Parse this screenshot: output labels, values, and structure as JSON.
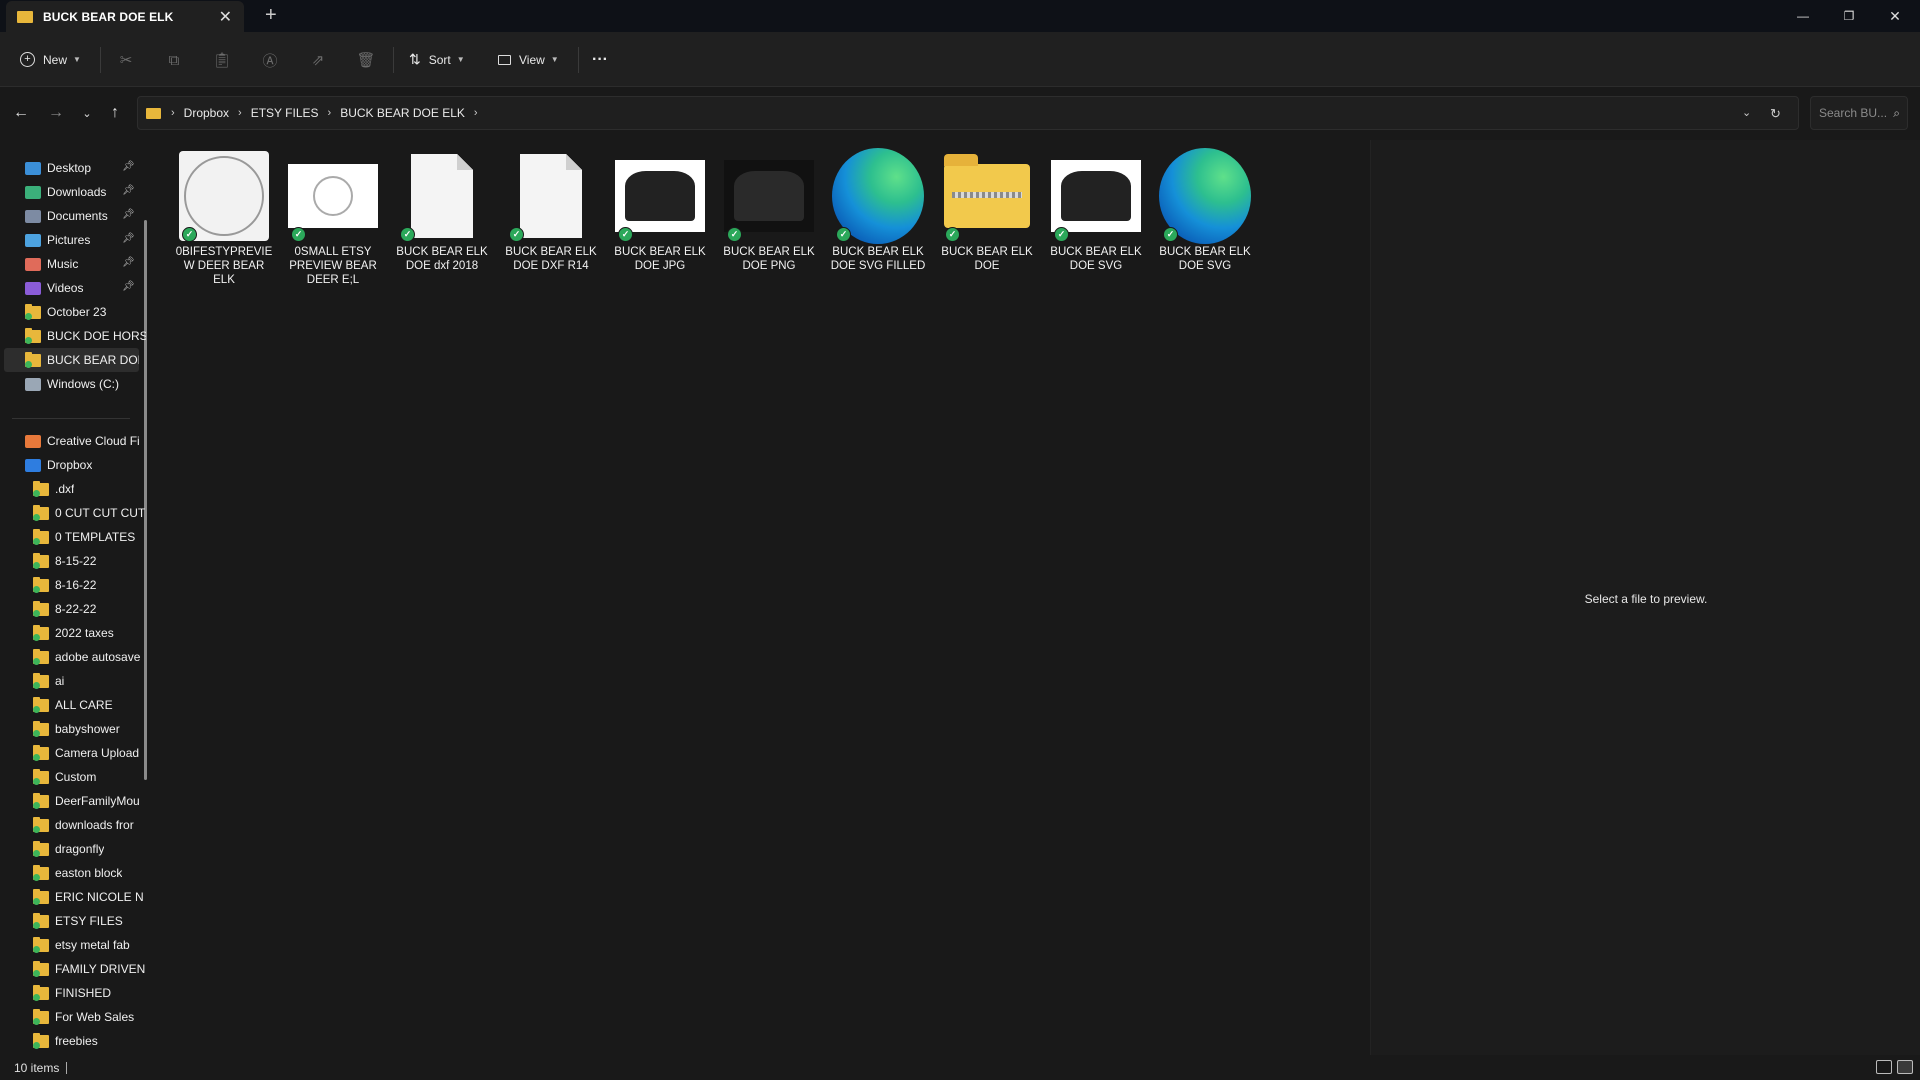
{
  "window": {
    "tab_title": "BUCK BEAR DOE ELK",
    "tab_close": "✕",
    "new_tab": "+",
    "minimize": "—",
    "maximize": "❐",
    "close": "✕"
  },
  "toolbar": {
    "new_label": "New",
    "sort_label": "Sort",
    "view_label": "View",
    "more_label": "···"
  },
  "address": {
    "crumbs": [
      "Dropbox",
      "ETSY FILES",
      "BUCK BEAR DOE ELK"
    ],
    "search_placeholder": "Search BU..."
  },
  "sidebar": {
    "quick_access": [
      {
        "label": "Desktop",
        "icon": "desktop-icon",
        "pinned": true
      },
      {
        "label": "Downloads",
        "icon": "download-icon",
        "pinned": true
      },
      {
        "label": "Documents",
        "icon": "documents-icon",
        "pinned": true
      },
      {
        "label": "Pictures",
        "icon": "pictures-icon",
        "pinned": true
      },
      {
        "label": "Music",
        "icon": "music-icon",
        "pinned": true
      },
      {
        "label": "Videos",
        "icon": "videos-icon",
        "pinned": true
      },
      {
        "label": "October 23",
        "icon": "folder-icon",
        "pinned": false
      },
      {
        "label": "BUCK DOE HORS",
        "icon": "folder-icon",
        "pinned": false
      },
      {
        "label": "BUCK BEAR DOE",
        "icon": "folder-icon",
        "pinned": false,
        "selected": true
      },
      {
        "label": "Windows (C:)",
        "icon": "drive-icon",
        "pinned": false
      }
    ],
    "creative_cloud": "Creative Cloud Fi",
    "dropbox": "Dropbox",
    "dropbox_folders": [
      ".dxf",
      "0 CUT CUT CUT",
      "0 TEMPLATES",
      "8-15-22",
      "8-16-22",
      "8-22-22",
      "2022 taxes",
      "adobe autosave",
      "ai",
      "ALL CARE",
      "babyshower",
      "Camera Upload",
      "Custom",
      "DeerFamilyMou",
      "downloads fror",
      "dragonfly",
      "easton block",
      "ERIC NICOLE N",
      "ETSY FILES",
      "etsy metal fab",
      "FAMILY DRIVEN",
      "FINISHED",
      "For Web Sales",
      "freebies"
    ]
  },
  "files": [
    {
      "name": "0BIFESTYPREVIEW DEER BEAR ELK",
      "thumb": "round-preview"
    },
    {
      "name": "0SMALL ETSY PREVIEW BEAR DEER E;L",
      "thumb": "small-preview"
    },
    {
      "name": "BUCK BEAR ELK DOE dxf 2018",
      "thumb": "document"
    },
    {
      "name": "BUCK BEAR ELK DOE DXF R14",
      "thumb": "document"
    },
    {
      "name": "BUCK BEAR ELK DOE JPG",
      "thumb": "image-light"
    },
    {
      "name": "BUCK BEAR ELK DOE PNG",
      "thumb": "image-dark"
    },
    {
      "name": "BUCK BEAR ELK DOE SVG FILLED",
      "thumb": "edge"
    },
    {
      "name": "BUCK BEAR ELK DOE",
      "thumb": "zip"
    },
    {
      "name": "BUCK BEAR ELK DOE SVG",
      "thumb": "image-light"
    },
    {
      "name": "BUCK BEAR ELK DOE SVG",
      "thumb": "edge"
    }
  ],
  "preview": {
    "message": "Select a file to preview."
  },
  "status": {
    "count": "10 items"
  },
  "colors": {
    "accent_folder": "#e8b73b",
    "sync_green": "#2ba85a",
    "background": "#191919"
  }
}
